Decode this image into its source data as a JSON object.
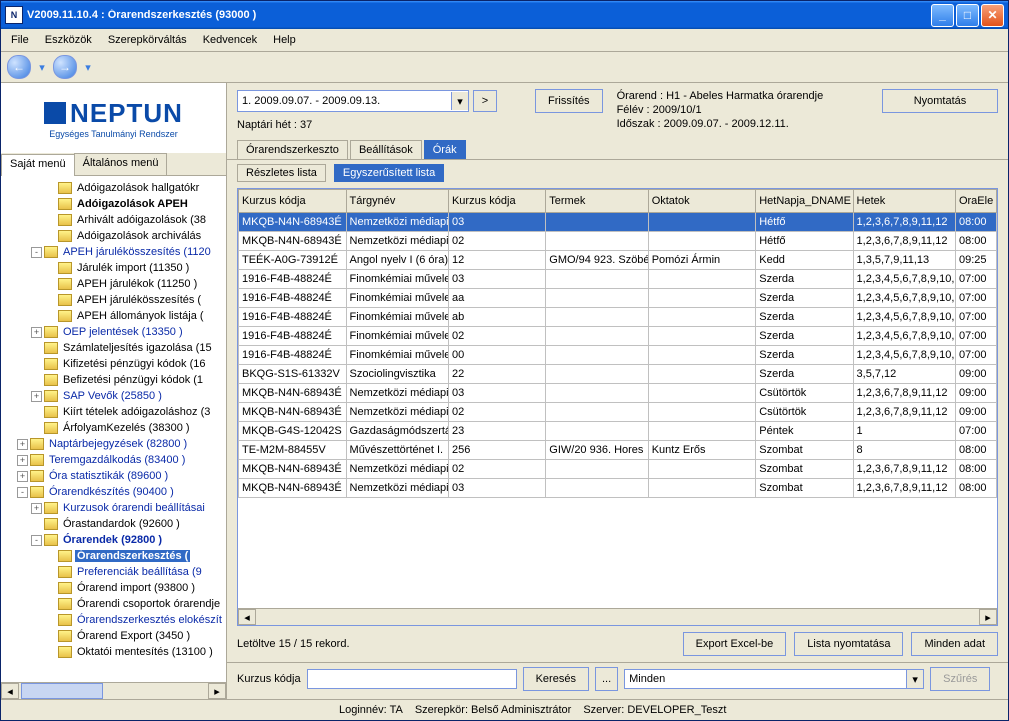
{
  "title": "V2009.11.10.4 : Órarendszerkesztés (93000  )",
  "menu": [
    "File",
    "Eszközök",
    "Szerepkörváltás",
    "Kedvencek",
    "Help"
  ],
  "logo": {
    "main": "NEPTUN",
    "sub": "Egységes Tanulmányi Rendszer"
  },
  "left_tabs": {
    "a": "Saját menü",
    "b": "Általános menü"
  },
  "tree": [
    {
      "ind": 1,
      "exp": "",
      "lbl": "Adóigazolások hallgatókr",
      "cls": ""
    },
    {
      "ind": 1,
      "exp": "",
      "lbl": "Adóigazolások APEH",
      "cls": "bold"
    },
    {
      "ind": 1,
      "exp": "",
      "lbl": "Arhivált adóigazolások (38",
      "cls": ""
    },
    {
      "ind": 1,
      "exp": "",
      "lbl": "Adóigazolások archiválás",
      "cls": ""
    },
    {
      "ind": 0,
      "exp": "-",
      "lbl": "APEH járulékösszesítés (1120",
      "cls": "blue"
    },
    {
      "ind": 1,
      "exp": "",
      "lbl": "Járulék import (11350  )",
      "cls": ""
    },
    {
      "ind": 1,
      "exp": "",
      "lbl": "APEH járulékok (11250  )",
      "cls": ""
    },
    {
      "ind": 1,
      "exp": "",
      "lbl": "APEH járulékösszesítés (",
      "cls": ""
    },
    {
      "ind": 1,
      "exp": "",
      "lbl": "APEH állományok listája (",
      "cls": ""
    },
    {
      "ind": 0,
      "exp": "+",
      "lbl": "OEP jelentések (13350  )",
      "cls": "blue"
    },
    {
      "ind": 0,
      "exp": "",
      "lbl": "Számlateljesítés igazolása (15",
      "cls": ""
    },
    {
      "ind": 0,
      "exp": "",
      "lbl": "Kifizetési pénzügyi kódok (16",
      "cls": ""
    },
    {
      "ind": 0,
      "exp": "",
      "lbl": "Befizetési pénzügyi kódok (1",
      "cls": ""
    },
    {
      "ind": 0,
      "exp": "+",
      "lbl": "SAP Vevők (25850  )",
      "cls": "blue"
    },
    {
      "ind": 0,
      "exp": "",
      "lbl": "Kiírt tételek adóigazoláshoz (3",
      "cls": ""
    },
    {
      "ind": 0,
      "exp": "",
      "lbl": "ÁrfolyamKezelés (38300  )",
      "cls": ""
    },
    {
      "ind": -1,
      "exp": "+",
      "lbl": "Naptárbejegyzések (82800  )",
      "cls": "blue"
    },
    {
      "ind": -1,
      "exp": "+",
      "lbl": "Teremgazdálkodás (83400  )",
      "cls": "blue"
    },
    {
      "ind": -1,
      "exp": "+",
      "lbl": "Óra statisztikák (89600  )",
      "cls": "blue"
    },
    {
      "ind": -1,
      "exp": "-",
      "lbl": "Órarendkészítés (90400  )",
      "cls": "blue"
    },
    {
      "ind": 0,
      "exp": "+",
      "lbl": "Kurzusok órarendi beállításai",
      "cls": "blue"
    },
    {
      "ind": 0,
      "exp": "",
      "lbl": "Órastandardok (92600  )",
      "cls": ""
    },
    {
      "ind": 0,
      "exp": "-",
      "lbl": "Órarendek (92800  )",
      "cls": "bold blue"
    },
    {
      "ind": 1,
      "exp": "",
      "lbl": "Órarendszerkesztés (",
      "cls": "sel bold"
    },
    {
      "ind": 1,
      "exp": "",
      "lbl": "Preferenciák beállítása (9",
      "cls": "blue"
    },
    {
      "ind": 1,
      "exp": "",
      "lbl": "Órarend import (93800  )",
      "cls": ""
    },
    {
      "ind": 1,
      "exp": "",
      "lbl": "Órarendi csoportok órarendje",
      "cls": ""
    },
    {
      "ind": 1,
      "exp": "",
      "lbl": "Órarendszerkesztés elokészít",
      "cls": "blue"
    },
    {
      "ind": 1,
      "exp": "",
      "lbl": "Órarend Export (3450  )",
      "cls": ""
    },
    {
      "ind": 1,
      "exp": "",
      "lbl": "Oktatói mentesítés (13100  )",
      "cls": ""
    }
  ],
  "top": {
    "week_select": "1. 2009.09.07. - 2009.09.13.",
    "go": ">",
    "refresh": "Frissítés",
    "info1": "Órarend : H1 - Abeles Harmatka órarendje",
    "info2": "Félév : 2009/10/1",
    "info3": "Időszak : 2009.09.07. - 2009.12.11.",
    "print": "Nyomtatás",
    "calweek": "Naptári hét : 37"
  },
  "tabs": {
    "a": "Órarendszerkeszto",
    "b": "Beállítások",
    "c": "Órák"
  },
  "subtabs": {
    "a": "Részletes lista",
    "b": "Egyszerűsített lista"
  },
  "columns": [
    "Kurzus kódja",
    "Tárgynév",
    "Kurzus kódja",
    "Termek",
    "Oktatok",
    "HetNapja_DNAME",
    "Hetek",
    "OraEle"
  ],
  "rows": [
    [
      "MKQB-N4N-68943É",
      "Nemzetközi médiapia",
      "03",
      "",
      "",
      "Hétfő",
      "1,2,3,6,7,8,9,11,12",
      "08:00"
    ],
    [
      "MKQB-N4N-68943É",
      "Nemzetközi médiapia",
      "02",
      "",
      "",
      "Hétfő",
      "1,2,3,6,7,8,9,11,12",
      "08:00"
    ],
    [
      "TEÉK-A0G-73912É",
      "Angol nyelv I (6 óra)",
      "12",
      "GMO/94 923. Szöbé",
      "Pomózi Ármin",
      "Kedd",
      "1,3,5,7,9,11,13",
      "09:25"
    ],
    [
      "1916-F4B-48824É",
      "Finomkémiai művele",
      "03",
      "",
      "",
      "Szerda",
      "1,2,3,4,5,6,7,8,9,10,",
      "07:00"
    ],
    [
      "1916-F4B-48824É",
      "Finomkémiai művele",
      "aa",
      "",
      "",
      "Szerda",
      "1,2,3,4,5,6,7,8,9,10,",
      "07:00"
    ],
    [
      "1916-F4B-48824É",
      "Finomkémiai művele",
      "ab",
      "",
      "",
      "Szerda",
      "1,2,3,4,5,6,7,8,9,10,",
      "07:00"
    ],
    [
      "1916-F4B-48824É",
      "Finomkémiai művele",
      "02",
      "",
      "",
      "Szerda",
      "1,2,3,4,5,6,7,8,9,10,",
      "07:00"
    ],
    [
      "1916-F4B-48824É",
      "Finomkémiai művele",
      "00",
      "",
      "",
      "Szerda",
      "1,2,3,4,5,6,7,8,9,10,",
      "07:00"
    ],
    [
      "BKQG-S1S-61332V",
      "Szociolingvisztika",
      "22",
      "",
      "",
      "Szerda",
      "3,5,7,12",
      "09:00"
    ],
    [
      "MKQB-N4N-68943É",
      "Nemzetközi médiapia",
      "03",
      "",
      "",
      "Csütörtök",
      "1,2,3,6,7,8,9,11,12",
      "09:00"
    ],
    [
      "MKQB-N4N-68943É",
      "Nemzetközi médiapia",
      "02",
      "",
      "",
      "Csütörtök",
      "1,2,3,6,7,8,9,11,12",
      "09:00"
    ],
    [
      "MKQB-G4S-12042S",
      "Gazdaságmódszertá",
      "23",
      "",
      "",
      "Péntek",
      "1",
      "07:00"
    ],
    [
      "TE-M2M-88455V",
      "Művészettörténet I.",
      "256",
      "GIW/20 936. Hores",
      "Kuntz Erős",
      "Szombat",
      "8",
      "08:00"
    ],
    [
      "MKQB-N4N-68943É",
      "Nemzetközi médiapia",
      "02",
      "",
      "",
      "Szombat",
      "1,2,3,6,7,8,9,11,12",
      "08:00"
    ],
    [
      "MKQB-N4N-68943É",
      "Nemzetközi médiapia",
      "03",
      "",
      "",
      "Szombat",
      "1,2,3,6,7,8,9,11,12",
      "08:00"
    ]
  ],
  "below": {
    "loaded": "Letöltve 15 / 15 rekord.",
    "excel": "Export Excel-be",
    "listprint": "Lista nyomtatása",
    "alldata": "Minden adat"
  },
  "search": {
    "label": "Kurzus kódja",
    "search_btn": "Keresés",
    "dots": "...",
    "combo": "Minden",
    "filter": "Szűrés"
  },
  "status": {
    "login": "Loginnév: TA",
    "role": "Szerepkör: Belső Adminisztrátor",
    "server": "Szerver: DEVELOPER_Teszt"
  }
}
